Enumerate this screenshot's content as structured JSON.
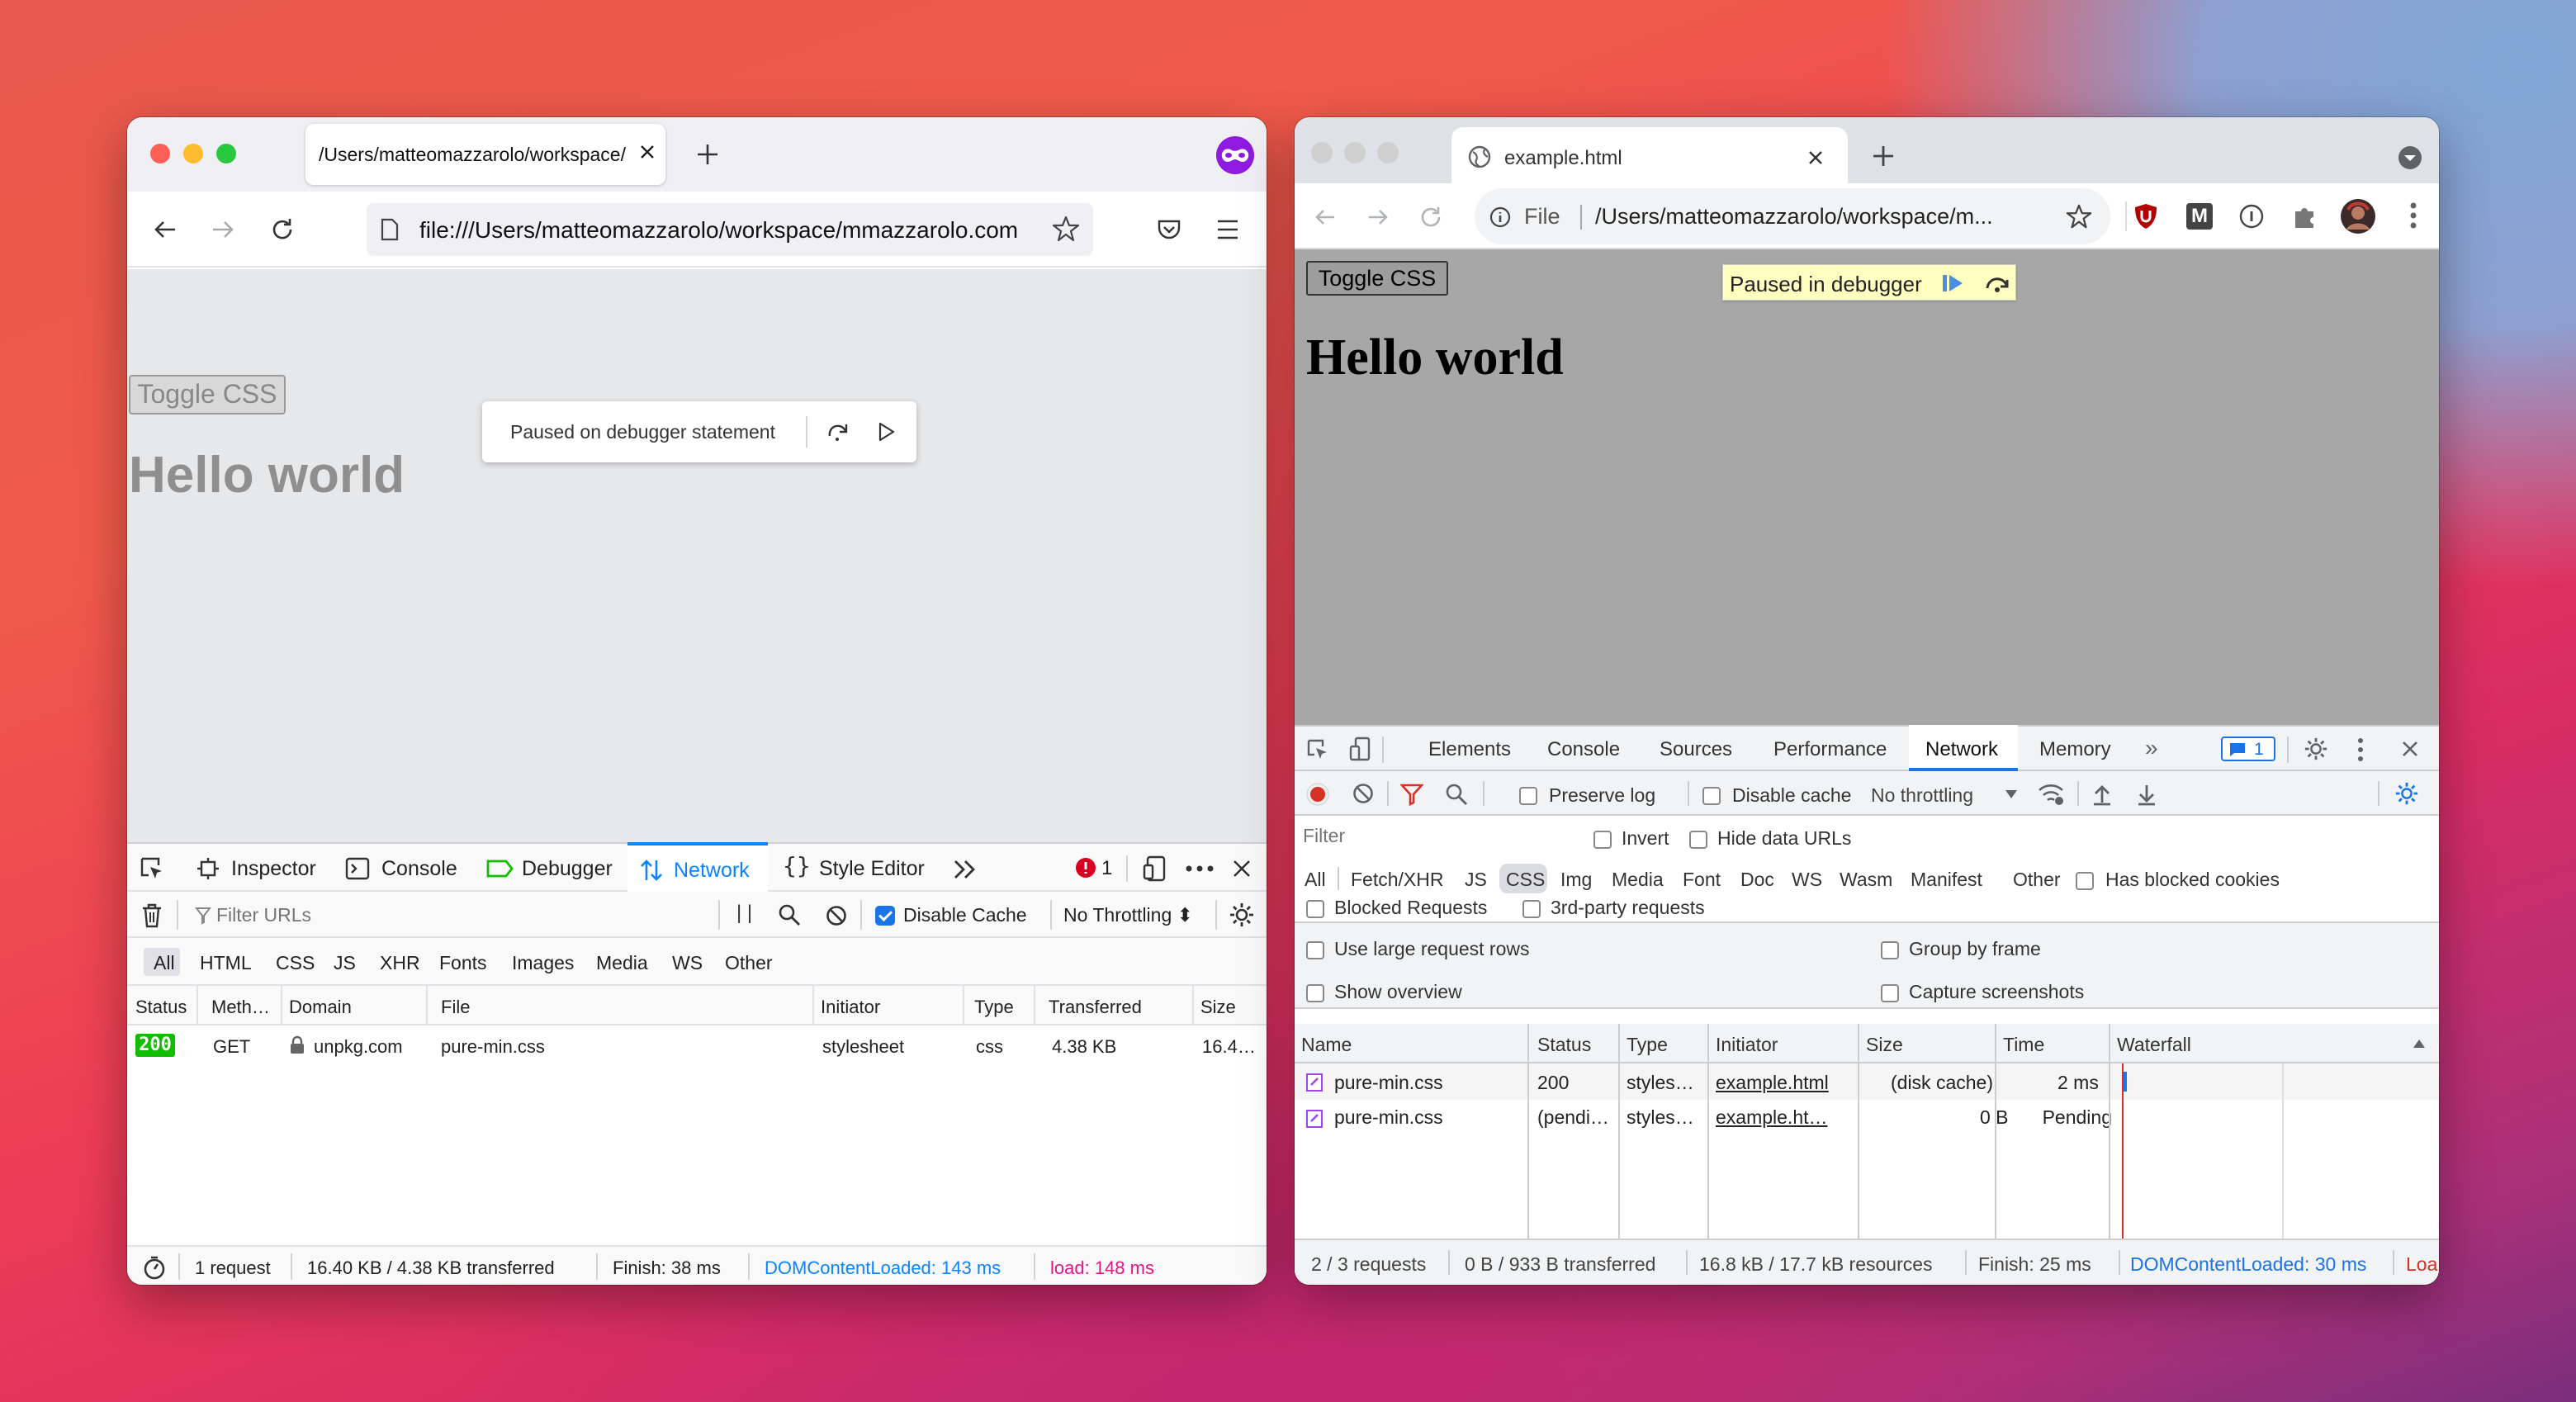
{
  "firefox": {
    "tab_title": "/Users/matteomazzarolo/workspace/",
    "url": "file:///Users/matteomazzarolo/workspace/mmazzarolo.com",
    "toggle_css": "Toggle CSS",
    "heading": "Hello world",
    "paused_text": "Paused on debugger statement",
    "devtools_tabs": [
      "Inspector",
      "Console",
      "Debugger",
      "Network",
      "Style Editor"
    ],
    "error_count": "1",
    "filter_placeholder": "Filter URLs",
    "disable_cache": "Disable Cache",
    "throttling": "No Throttling ⬍",
    "type_filters": [
      "All",
      "HTML",
      "CSS",
      "JS",
      "XHR",
      "Fonts",
      "Images",
      "Media",
      "WS",
      "Other"
    ],
    "columns": [
      "Status",
      "Meth…",
      "Domain",
      "File",
      "Initiator",
      "Type",
      "Transferred",
      "Size"
    ],
    "rows": [
      {
        "status": "200",
        "method": "GET",
        "domain": "unpkg.com",
        "file": "pure-min.css",
        "initiator": "stylesheet",
        "type": "css",
        "transferred": "4.38 KB",
        "size": "16.4…"
      }
    ],
    "footer": {
      "requests": "1 request",
      "transferred": "16.40 KB / 4.38 KB transferred",
      "finish": "Finish: 38 ms",
      "dcl": "DOMContentLoaded: 143 ms",
      "load": "load: 148 ms"
    }
  },
  "chrome": {
    "tab_title": "example.html",
    "url_prefix": "File",
    "url": "/Users/matteomazzarolo/workspace/m...",
    "ext_m": "M",
    "toggle_css": "Toggle CSS",
    "heading": "Hello world",
    "paused_text": "Paused in debugger",
    "devtools_tabs": [
      "Elements",
      "Console",
      "Sources",
      "Performance",
      "Network",
      "Memory"
    ],
    "msg_count": "1",
    "preserve_log": "Preserve log",
    "disable_cache": "Disable cache",
    "throttling": "No throttling",
    "filter_placeholder": "Filter",
    "invert": "Invert",
    "hide_data_urls": "Hide data URLs",
    "type_filters": [
      "All",
      "Fetch/XHR",
      "JS",
      "CSS",
      "Img",
      "Media",
      "Font",
      "Doc",
      "WS",
      "Wasm",
      "Manifest",
      "Other"
    ],
    "has_blocked_cookies": "Has blocked cookies",
    "blocked_requests": "Blocked Requests",
    "third_party": "3rd-party requests",
    "large_rows": "Use large request rows",
    "group_by_frame": "Group by frame",
    "show_overview": "Show overview",
    "capture_screenshots": "Capture screenshots",
    "columns": [
      "Name",
      "Status",
      "Type",
      "Initiator",
      "Size",
      "Time",
      "Waterfall"
    ],
    "rows": [
      {
        "name": "pure-min.css",
        "status": "200",
        "type": "styles…",
        "initiator": "example.html",
        "size": "(disk cache)",
        "time": "2 ms"
      },
      {
        "name": "pure-min.css",
        "status": "(pendi…",
        "type": "styles…",
        "initiator": "example.ht…",
        "size": "0 B",
        "time": "Pending"
      }
    ],
    "footer": {
      "requests": "2 / 3 requests",
      "transferred": "0 B / 933 B transferred",
      "resources": "16.8 kB / 17.7 kB resources",
      "finish": "Finish: 25 ms",
      "dcl": "DOMContentLoaded: 30 ms",
      "load": "Loa"
    }
  }
}
